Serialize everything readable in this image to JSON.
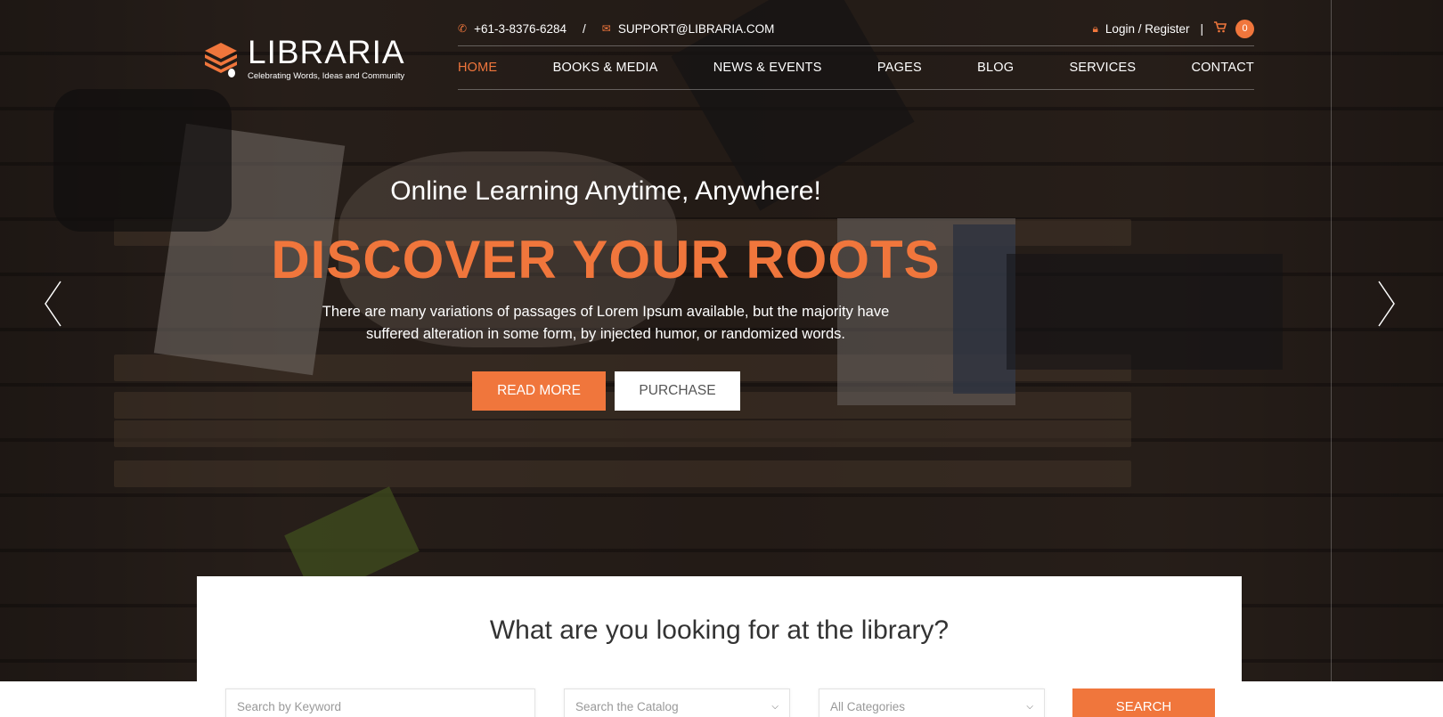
{
  "header": {
    "logo_name": "LIBRARIA",
    "logo_tagline": "Celebrating Words, Ideas and Community",
    "phone": "+61-3-8376-6284",
    "separator": "/",
    "email": "SUPPORT@LIBRARIA.COM",
    "login_label": "Login / Register",
    "pipe": "|",
    "cart_count": "0"
  },
  "nav": {
    "items": [
      {
        "label": "HOME",
        "active": true
      },
      {
        "label": "BOOKS & MEDIA"
      },
      {
        "label": "NEWS & EVENTS"
      },
      {
        "label": "PAGES"
      },
      {
        "label": "BLOG"
      },
      {
        "label": "SERVICES"
      },
      {
        "label": "CONTACT"
      }
    ]
  },
  "hero": {
    "subtitle": "Online Learning Anytime, Anywhere!",
    "title": "DISCOVER YOUR ROOTS",
    "description": "There are many variations of passages of Lorem Ipsum available, but the majority have suffered alteration in some form, by injected humor, or randomized words.",
    "read_more_label": "READ MORE",
    "purchase_label": "PURCHASE"
  },
  "search": {
    "heading": "What are you looking for at the library?",
    "keyword_placeholder": "Search by Keyword",
    "catalog_placeholder": "Search the Catalog",
    "category_value": "All Categories",
    "search_label": "SEARCH"
  },
  "colors": {
    "accent": "#f0763c",
    "text_dark": "#333333"
  },
  "icons": [
    "phone-icon",
    "mail-icon",
    "lock-icon",
    "cart-icon",
    "chevron-left-icon",
    "chevron-right-icon",
    "chevron-down-icon"
  ]
}
